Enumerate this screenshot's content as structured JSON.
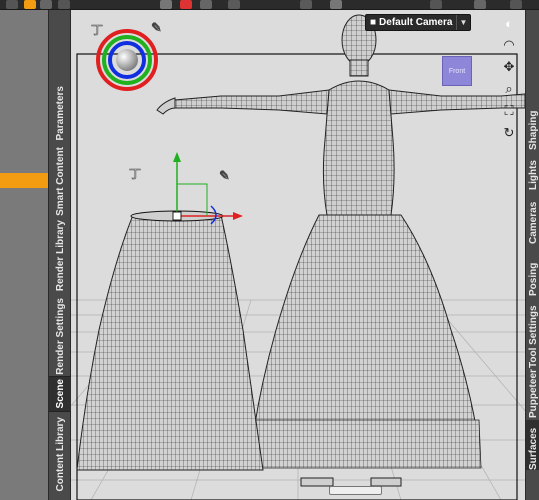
{
  "left_tabs": [
    {
      "label": "Parameters",
      "active": false
    },
    {
      "label": "Smart Content",
      "active": false
    },
    {
      "label": "Render Library",
      "active": false
    },
    {
      "label": "Render Settings",
      "active": false
    },
    {
      "label": "Scene",
      "active": true
    },
    {
      "label": "Content Library",
      "active": false
    }
  ],
  "right_tabs": [
    {
      "label": "Shaping",
      "active": false
    },
    {
      "label": "Lights",
      "active": false
    },
    {
      "label": "Cameras",
      "active": false
    },
    {
      "label": "Posing",
      "active": false
    },
    {
      "label": "Tool Settings",
      "active": false
    },
    {
      "label": "Puppeteer",
      "active": false
    },
    {
      "label": "Surfaces",
      "active": true
    }
  ],
  "viewport": {
    "camera_label": "Default Camera",
    "view_cube_label": "Front"
  },
  "icons": {
    "camera": "camera-icon",
    "dropdown": "chevron-down-icon",
    "view_options": "viewport-options-icon",
    "pan": "pan-icon",
    "orbit": "orbit-icon",
    "zoom": "zoom-icon",
    "frame": "frame-icon",
    "reset": "reset-view-icon",
    "translate_gizmo": "universal-tool-icon",
    "pin": "pin-icon"
  },
  "colors": {
    "selection_accent": "#f39c12",
    "view_cube": "#8e86d8",
    "gizmo_red": "#e02020",
    "gizmo_green": "#20b020",
    "gizmo_blue": "#1030e0"
  }
}
